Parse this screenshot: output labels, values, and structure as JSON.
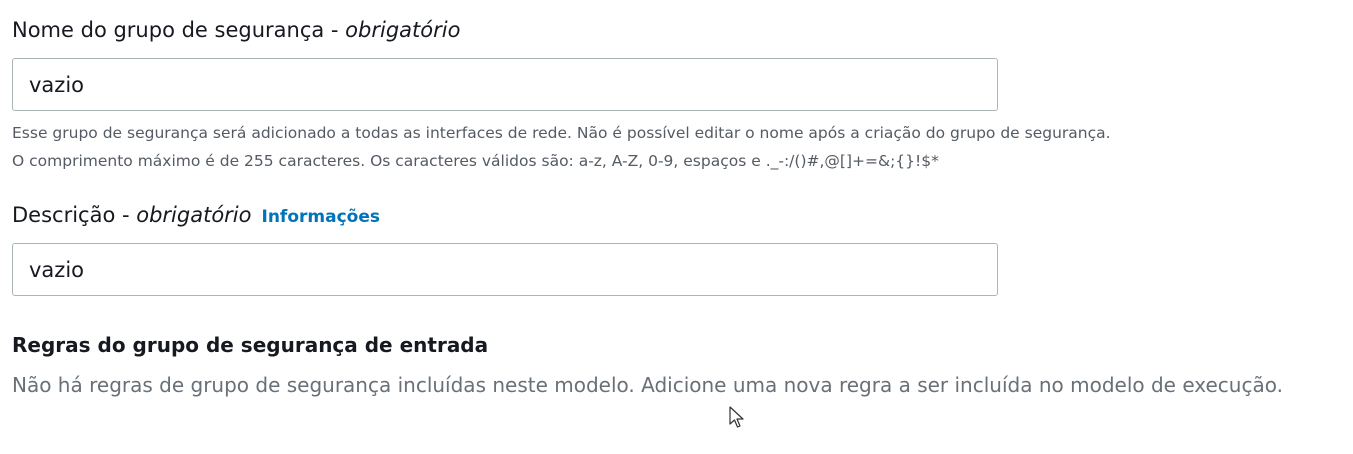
{
  "name_field": {
    "label": "Nome do grupo de segurança - ",
    "required": "obrigatório",
    "value": "vazio",
    "hint_line1": "Esse grupo de segurança será adicionado a todas as interfaces de rede. Não é possível editar o nome após a criação do grupo de segurança.",
    "hint_line2": "O comprimento máximo é de 255 caracteres. Os caracteres válidos são: a-z, A-Z, 0-9, espaços e ._-:/()#,@[]+=&;{}!$*"
  },
  "description_field": {
    "label": "Descrição - ",
    "required": "obrigatório",
    "info_link": "Informações",
    "value": "vazio"
  },
  "inbound_rules": {
    "title": "Regras do grupo de segurança de entrada",
    "description": "Não há regras de grupo de segurança incluídas neste modelo. Adicione uma nova regra a ser incluída no modelo de execução."
  },
  "colors": {
    "link": "#0073bb",
    "text": "#16191f",
    "hint": "#545b64",
    "border": "#aab7b8"
  }
}
